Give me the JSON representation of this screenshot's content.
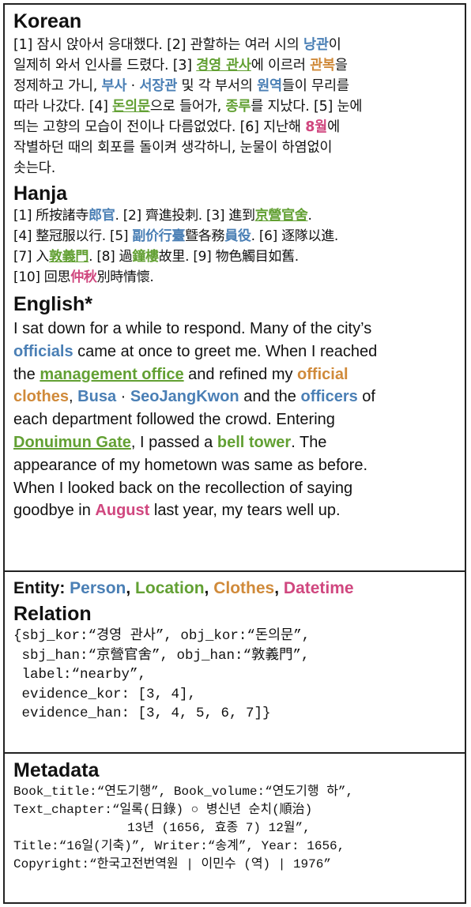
{
  "korean": {
    "heading": "Korean",
    "lines": [
      [
        {
          "t": "[1] 잠시 앉아서 응대했다. [2] 관할하는 여러 시의 "
        },
        {
          "t": "낭관",
          "c": "P"
        },
        {
          "t": "이"
        }
      ],
      [
        {
          "t": "일제히 와서 인사를 드렸다. [3] "
        },
        {
          "t": "경영 관사",
          "c": "L",
          "u": true
        },
        {
          "t": "에 이르러 "
        },
        {
          "t": "관복",
          "c": "C"
        },
        {
          "t": "을"
        }
      ],
      [
        {
          "t": "정제하고 가니, "
        },
        {
          "t": "부사",
          "c": "P"
        },
        {
          "t": " · "
        },
        {
          "t": "서장관",
          "c": "P"
        },
        {
          "t": " 및 각 부서의 "
        },
        {
          "t": "원역",
          "c": "P"
        },
        {
          "t": "들이 무리를"
        }
      ],
      [
        {
          "t": "따라 나갔다. [4] "
        },
        {
          "t": "돈의문",
          "c": "L",
          "u": true
        },
        {
          "t": "으로 들어가, "
        },
        {
          "t": "종루",
          "c": "L"
        },
        {
          "t": "를 지났다. [5] 눈에"
        }
      ],
      [
        {
          "t": "띄는 고향의 모습이 전이나 다름없었다. [6] 지난해 "
        },
        {
          "t": "8월",
          "c": "D"
        },
        {
          "t": "에"
        }
      ],
      [
        {
          "t": "작별하던 때의 회포를 돌이켜 생각하니, 눈물이 하염없이"
        }
      ],
      [
        {
          "t": "솟는다."
        }
      ]
    ]
  },
  "hanja": {
    "heading": "Hanja",
    "lines": [
      [
        {
          "t": "[1] 所按諸寺"
        },
        {
          "t": "郎官",
          "c": "P"
        },
        {
          "t": ". [2] 齊進投刺. [3] 進到"
        },
        {
          "t": "京營官舍",
          "c": "L",
          "u": true
        },
        {
          "t": "."
        }
      ],
      [
        {
          "t": "[4] 整冠服以行. [5] "
        },
        {
          "t": "副价行臺",
          "c": "P"
        },
        {
          "t": "曁各務"
        },
        {
          "t": "員役",
          "c": "P"
        },
        {
          "t": ". [6] 逐隊以進."
        }
      ],
      [
        {
          "t": "[7] 入"
        },
        {
          "t": "敦義門",
          "c": "L",
          "u": true
        },
        {
          "t": ". [8] 過"
        },
        {
          "t": "鐘樓",
          "c": "L"
        },
        {
          "t": "故里. [9] 物色觸目如舊."
        }
      ],
      [
        {
          "t": "[10] 回思"
        },
        {
          "t": "仲秋",
          "c": "D"
        },
        {
          "t": "別時情懷."
        }
      ]
    ]
  },
  "english": {
    "heading": "English*",
    "lines": [
      [
        {
          "t": "I sat down for a while to respond. Many of the city’s"
        }
      ],
      [
        {
          "t": "officials",
          "c": "P"
        },
        {
          "t": " came at once to greet me. When I reached"
        }
      ],
      [
        {
          "t": "the "
        },
        {
          "t": "management office",
          "c": "L",
          "u": true
        },
        {
          "t": " and refined my "
        },
        {
          "t": "official",
          "c": "C"
        }
      ],
      [
        {
          "t": "clothes",
          "c": "C"
        },
        {
          "t": ", "
        },
        {
          "t": "Busa",
          "c": "P"
        },
        {
          "t": " · "
        },
        {
          "t": "SeoJangKwon",
          "c": "P"
        },
        {
          "t": " and the "
        },
        {
          "t": "officers",
          "c": "P"
        },
        {
          "t": " of"
        }
      ],
      [
        {
          "t": "each department followed the crowd. Entering"
        }
      ],
      [
        {
          "t": "Donuimun Gate",
          "c": "L",
          "u": true
        },
        {
          "t": ", I passed a "
        },
        {
          "t": "bell tower",
          "c": "L"
        },
        {
          "t": ". The"
        }
      ],
      [
        {
          "t": "appearance of my hometown was same as before."
        }
      ],
      [
        {
          "t": "When I looked back on the recollection of saying"
        }
      ],
      [
        {
          "t": "goodbye in "
        },
        {
          "t": "August",
          "c": "D"
        },
        {
          "t": " last year, my tears well up."
        }
      ]
    ]
  },
  "entity": {
    "label": "Entity:",
    "types": [
      {
        "t": "Person",
        "c": "P"
      },
      {
        "t": "Location",
        "c": "L"
      },
      {
        "t": "Clothes",
        "c": "C"
      },
      {
        "t": "Datetime",
        "c": "D"
      }
    ]
  },
  "relation": {
    "heading": "Relation",
    "lines": [
      "{sbj_kor:“경영 관사”, obj_kor:“돈의문”,",
      " sbj_han:“京營官舍”, obj_han:“敦義門”,",
      " label:“nearby”,",
      " evidence_kor: [3, 4],",
      " evidence_han: [3, 4, 5, 6, 7]}"
    ]
  },
  "metadata": {
    "heading": "Metadata",
    "lines": [
      "Book_title:“연도기행”, Book_volume:“연도기행 하”,",
      "Text_chapter:“일록(日錄) ○ 병신년 순치(順治)",
      "               13년 (1656, 효종 7) 12월”,",
      "Title:“16일(기축)”, Writer:“송계”, Year: 1656,",
      "Copyright:“한국고전번역원 | 이민수 (역) | 1976”"
    ]
  },
  "colors": {
    "person": "#4a7fb5",
    "location": "#62a033",
    "clothes": "#d08a3a",
    "datetime": "#d0477f"
  }
}
